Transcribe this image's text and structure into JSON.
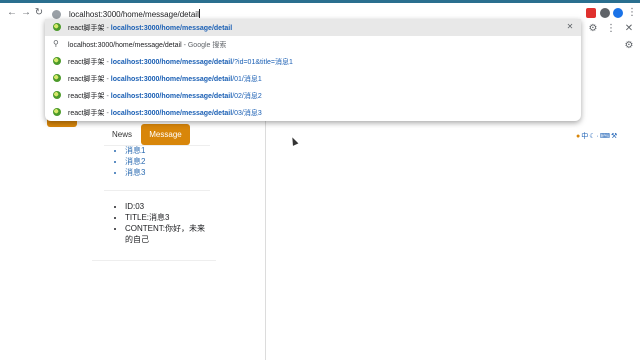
{
  "browser": {
    "address_value": "localhost:3000/home/message/detail",
    "suggestions": [
      {
        "icon": "page-icon",
        "site": "react脚手架",
        "sep": " - ",
        "url_bold": "localhost:3000/home/message/detail",
        "url_rest": "",
        "selected": true
      },
      {
        "icon": "search-icon",
        "query": "localhost:3000/home/message/detail",
        "suffix": " - Google 搜索"
      },
      {
        "icon": "page-icon",
        "site": "react脚手架",
        "sep": " - ",
        "url_bold": "localhost:3000/home/message/detail",
        "url_rest": "/?id=01&title=消息1"
      },
      {
        "icon": "page-icon",
        "site": "react脚手架",
        "sep": " - ",
        "url_bold": "localhost:3000/home/message/detail",
        "url_rest": "/01/消息1"
      },
      {
        "icon": "page-icon",
        "site": "react脚手架",
        "sep": " - ",
        "url_bold": "localhost:3000/home/message/detail",
        "url_rest": "/02/消息2"
      },
      {
        "icon": "page-icon",
        "site": "react脚手架",
        "sep": " - ",
        "url_bold": "localhost:3000/home/message/detail",
        "url_rest": "/03/消息3"
      }
    ],
    "toolbar_icons": [
      "back-arrow-icon",
      "forward-arrow-icon",
      "reload-icon",
      "gear-icon",
      "more-vert-icon",
      "close-icon"
    ]
  },
  "page": {
    "tabs": [
      {
        "label": "News",
        "active": false
      },
      {
        "label": "Message",
        "active": true
      }
    ],
    "messages": [
      "消息1",
      "消息2",
      "消息3"
    ],
    "detail": [
      "ID:03",
      "TITLE:消息3",
      "CONTENT:你好，未来的自己"
    ],
    "ime_label": "中"
  },
  "colors": {
    "accent": "#d8860a",
    "link": "#2a6ab0",
    "url_blue": "#1a5fb4"
  }
}
